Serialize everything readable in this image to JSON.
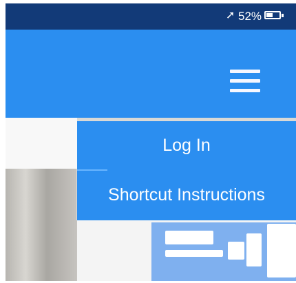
{
  "status_bar": {
    "location_icon": "location-arrow-icon",
    "location_symbol": "➚",
    "battery_percent": "52%",
    "battery_level": 0.52,
    "background": "#123a78"
  },
  "header": {
    "background": "#2b8ef0",
    "menu_icon": "hamburger-menu-icon"
  },
  "menu": {
    "items": [
      {
        "label": "Log In"
      },
      {
        "label": "Shortcut Instructions"
      }
    ]
  }
}
